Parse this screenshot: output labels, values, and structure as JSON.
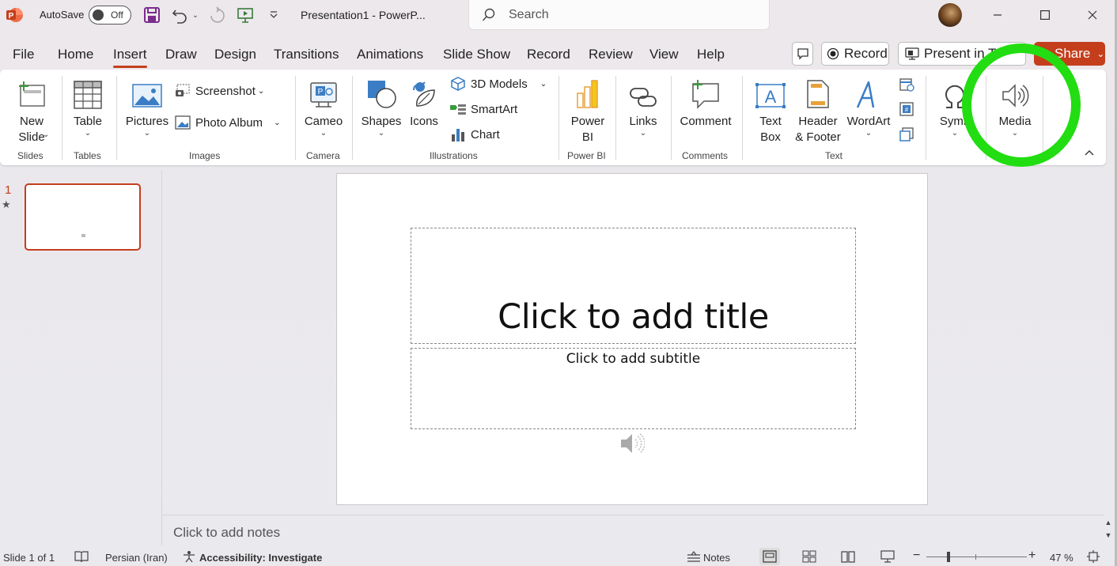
{
  "titlebar": {
    "autosave_label": "AutoSave",
    "autosave_state": "Off",
    "document_title": "Presentation1  -  PowerP...",
    "search_placeholder": "Search"
  },
  "tabs": [
    "File",
    "Home",
    "Insert",
    "Draw",
    "Design",
    "Transitions",
    "Animations",
    "Slide Show",
    "Record",
    "Review",
    "View",
    "Help"
  ],
  "active_tab": "Insert",
  "tab_actions": {
    "record_label": "Record",
    "present_label": "Present in T",
    "share_label": "Share"
  },
  "ribbon": {
    "new_slide": "New Slide",
    "table": "Table",
    "pictures": "Pictures",
    "screenshot": "Screenshot",
    "photo_album": "Photo Album",
    "cameo": "Cameo",
    "shapes": "Shapes",
    "icons": "Icons",
    "models_3d": "3D Models",
    "smartart": "SmartArt",
    "chart": "Chart",
    "power_bi": "Power BI",
    "links": "Links",
    "comment": "Comment",
    "text_box": "Text Box",
    "header_footer": "Header & Footer",
    "wordart": "WordArt",
    "symbols": "Symb",
    "media": "Media",
    "groups": {
      "slides": "Slides",
      "tables": "Tables",
      "images": "Images",
      "camera": "Camera",
      "illustrations": "Illustrations",
      "power_bi": "Power BI",
      "comments": "Comments",
      "text": "Text"
    }
  },
  "thumbnails": {
    "slide_number": "1",
    "star": "★"
  },
  "slide": {
    "title_placeholder": "Click to add title",
    "subtitle_placeholder": "Click to add subtitle"
  },
  "notes": {
    "placeholder": "Click to add notes"
  },
  "status": {
    "slide_info": "Slide 1 of 1",
    "language": "Persian (Iran)",
    "accessibility": "Accessibility: Investigate",
    "notes": "Notes",
    "zoom": "47 %"
  },
  "colors": {
    "accent": "#c43e1c",
    "highlight_ring": "#22dd11"
  }
}
